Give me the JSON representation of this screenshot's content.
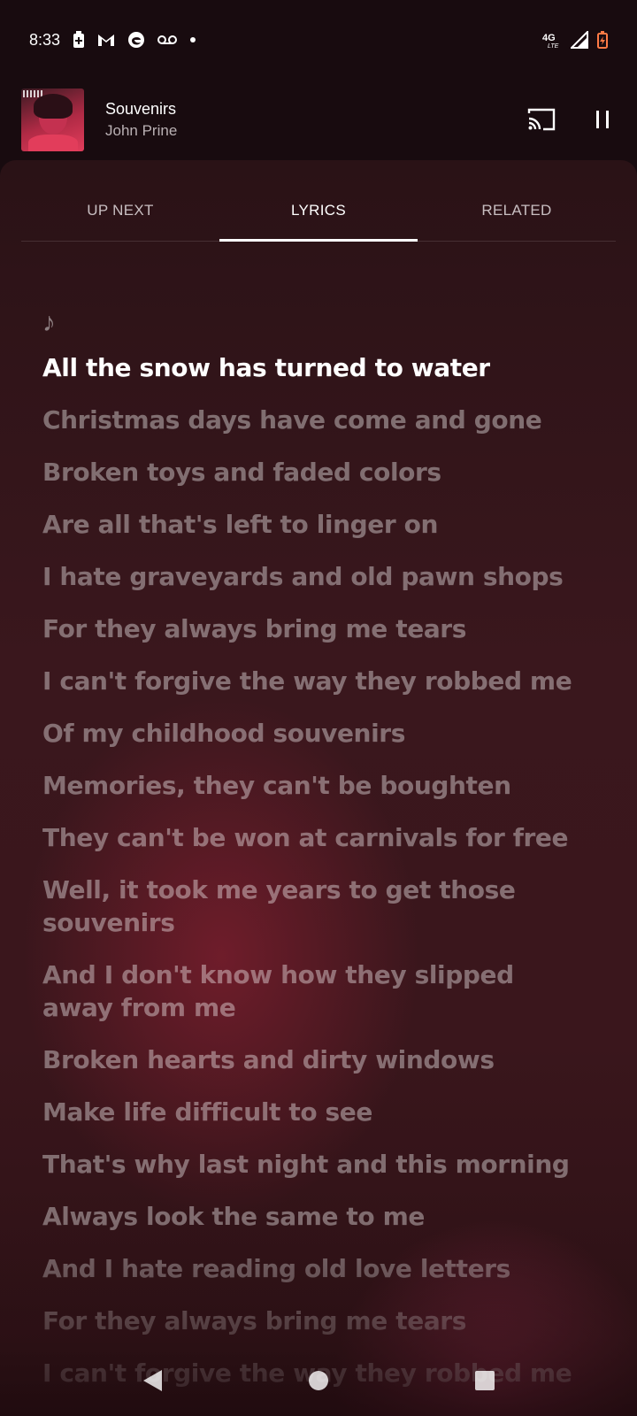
{
  "status_bar": {
    "time": "8:33",
    "left_icons": [
      "battery-saver-icon",
      "gmail-icon",
      "edge-browser-icon",
      "voicemail-icon",
      "dot-icon"
    ],
    "right_icons": [
      "4g-lte-icon",
      "signal-icon",
      "battery-charging-icon"
    ],
    "network_label": "4G"
  },
  "now_playing": {
    "title": "Souvenirs",
    "artist": "John Prine"
  },
  "tabs": [
    {
      "label": "UP NEXT",
      "active": false
    },
    {
      "label": "LYRICS",
      "active": true
    },
    {
      "label": "RELATED",
      "active": false
    }
  ],
  "lyrics": {
    "lines": [
      "All the snow has turned to water",
      "Christmas days have come and gone",
      "Broken toys and faded colors",
      "Are all that's left to linger on",
      "I hate graveyards and old pawn shops",
      "For they always bring me tears",
      "I can't forgive the way they robbed me",
      "Of my childhood souvenirs",
      "Memories, they can't be boughten",
      "They can't be won at carnivals for free",
      "Well, it took me years to get those souvenirs",
      "And I don't know how they slipped away from me",
      "Broken hearts and dirty windows",
      "Make life difficult to see",
      "That's why last night and this morning",
      "Always look the same to me",
      "And I hate reading old love letters",
      "For they always bring me tears",
      "I can't forgive the way they robbed me"
    ],
    "current_line": 0
  },
  "colors": {
    "background": "#180b0f",
    "sheet": "#3a171d",
    "accent_highlight": "#e23d5b",
    "battery_charging": "#ff7a45"
  }
}
